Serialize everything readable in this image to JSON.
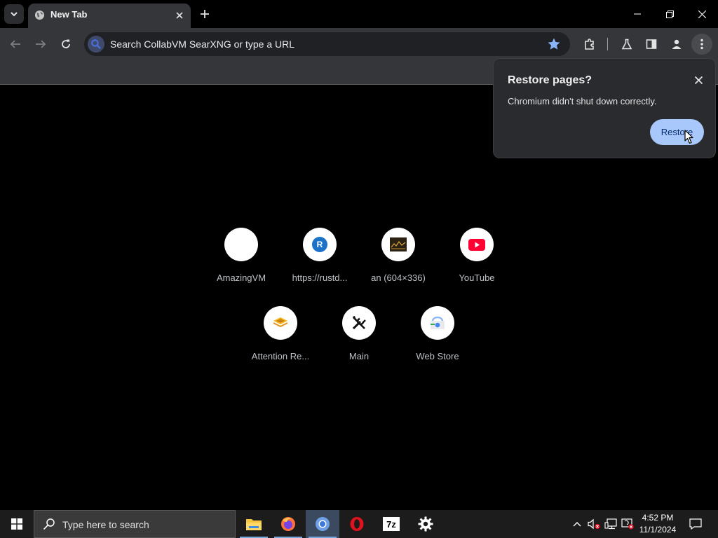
{
  "tabs": [
    {
      "title": "New Tab"
    }
  ],
  "omnibox": {
    "placeholder": "Search CollabVM SearXNG or type a URL"
  },
  "restore_bubble": {
    "title": "Restore pages?",
    "message": "Chromium didn't shut down correctly.",
    "button_label": "Restore"
  },
  "shortcuts": [
    {
      "label": "AmazingVM",
      "icon": "blank-favicon"
    },
    {
      "label": "https://rustd...",
      "icon": "letter-r-favicon",
      "letter": "R"
    },
    {
      "label": "an (604×336)",
      "icon": "image-thumbnail-favicon"
    },
    {
      "label": "YouTube",
      "icon": "youtube-icon"
    },
    {
      "label": "Attention Re...",
      "icon": "layers-icon"
    },
    {
      "label": "Main",
      "icon": "tools-icon"
    },
    {
      "label": "Web Store",
      "icon": "web-store-icon"
    }
  ],
  "taskbar": {
    "search_placeholder": "Type here to search",
    "apps": [
      "file-explorer",
      "firefox",
      "chromium",
      "opera",
      "7zip",
      "settings"
    ],
    "time": "4:52 PM",
    "date": "11/1/2024"
  },
  "colors": {
    "accent": "#a8c7fa",
    "toolbar": "#35363a",
    "youtube": "#ff0033"
  }
}
